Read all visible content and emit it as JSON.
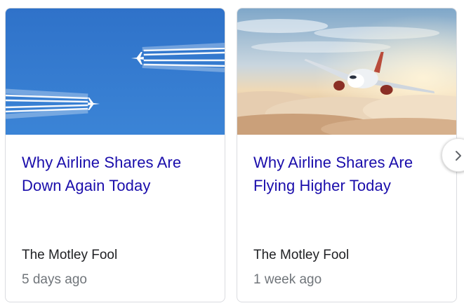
{
  "cards": [
    {
      "title": "Why Airline Shares Are Down Again Today",
      "source": "The Motley Fool",
      "age": "5 days ago",
      "image_icon": "contrails-sky-image"
    },
    {
      "title": "Why Airline Shares Are Flying Higher Today",
      "source": "The Motley Fool",
      "age": "1 week ago",
      "image_icon": "airplane-above-clouds-image"
    }
  ],
  "carousel": {
    "next_icon": "chevron-right-icon"
  },
  "colors": {
    "title_link": "#1a0dab",
    "source_text": "#202124",
    "age_text": "#70757a",
    "card_border": "#dadce0"
  }
}
